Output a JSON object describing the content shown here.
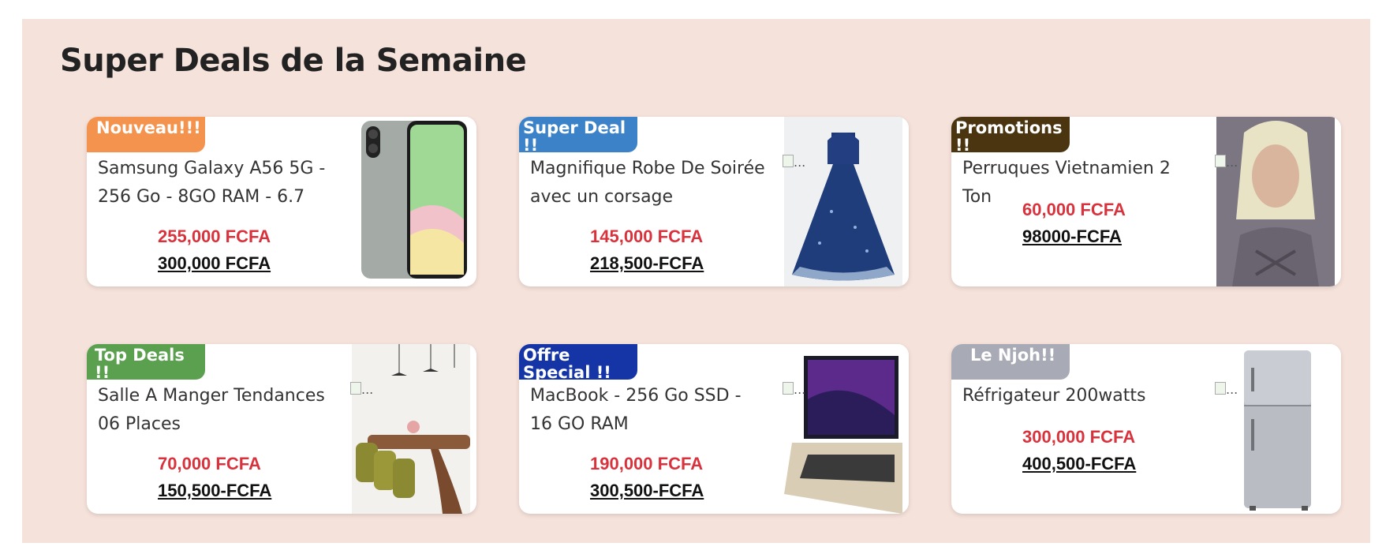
{
  "section": {
    "title": "Super Deals de la Semaine",
    "background": "#f5e2da"
  },
  "products": [
    {
      "badge": "Nouveau!!!",
      "badge_color": "#f4934e",
      "name": "Samsung Galaxy A56 5G - 256 Go - 8GO RAM - 6.7",
      "price": "255,000 FCFA",
      "old_price": "300,000 FCFA",
      "image_alt": "...",
      "image_icon": "phone-image"
    },
    {
      "badge": "Super Deal !!",
      "badge_color": "#3b82c8",
      "name": "Magnifique Robe De Soirée avec un corsage",
      "price": "145,000 FCFA",
      "old_price": "218,500-FCFA",
      "image_alt": "...",
      "image_icon": "dress-image"
    },
    {
      "badge": "Promotions !!",
      "badge_color": "#4a3510",
      "name": "Perruques Vietnamien 2 Ton",
      "price": "60,000 FCFA",
      "old_price": "98000-FCFA",
      "image_alt": "...",
      "image_icon": "wig-image"
    },
    {
      "badge": "Top Deals !!",
      "badge_color": "#5aa04e",
      "name": "Salle A Manger Tendances 06 Places",
      "price": "70,000 FCFA",
      "old_price": "150,500-FCFA",
      "image_alt": "...",
      "image_icon": "dining-table-image"
    },
    {
      "badge": "Offre Special !!",
      "badge_color": "#1535a6",
      "name": "MacBook - 256 Go SSD - 16 GO RAM",
      "price": "190,000 FCFA",
      "old_price": "300,500-FCFA",
      "image_alt": "...",
      "image_icon": "laptop-image"
    },
    {
      "badge": "Le Njoh!!",
      "badge_color": "#a8aab5",
      "name": "Réfrigateur 200watts",
      "price": "300,000 FCFA",
      "old_price": "400,500-FCFA",
      "image_alt": "...",
      "image_icon": "fridge-image"
    }
  ]
}
